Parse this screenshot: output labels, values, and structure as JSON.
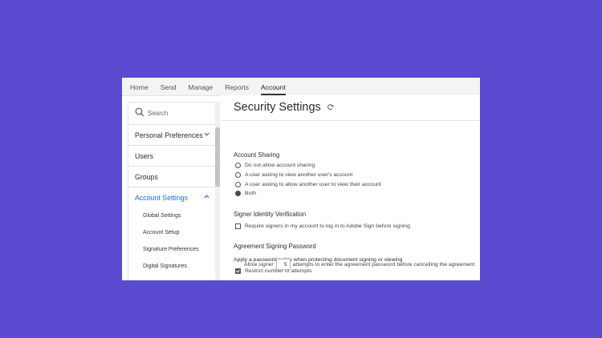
{
  "nav": {
    "items": [
      {
        "label": "Home"
      },
      {
        "label": "Send"
      },
      {
        "label": "Manage"
      },
      {
        "label": "Reports"
      },
      {
        "label": "Account"
      }
    ],
    "active": "Account"
  },
  "sidebar": {
    "search_placeholder": "Search",
    "items": [
      {
        "label": "Personal Preferences",
        "chevron": "chevron-down-icon"
      },
      {
        "label": "Users"
      },
      {
        "label": "Groups"
      },
      {
        "label": "Account Settings",
        "chevron": "chevron-up-icon"
      }
    ],
    "subitems": [
      {
        "label": "Global Settings"
      },
      {
        "label": "Account Setup"
      },
      {
        "label": "Signature Preferences"
      },
      {
        "label": "Digital Signatures"
      }
    ]
  },
  "main": {
    "title": "Security Settings",
    "account_sharing": {
      "heading": "Account Sharing",
      "options": [
        {
          "label": "Do not allow account sharing",
          "selected": false
        },
        {
          "label": "A user asking to view another user's account",
          "selected": false
        },
        {
          "label": "A user asking to allow another user to view their account",
          "selected": false
        },
        {
          "label": "Both",
          "selected": true
        }
      ]
    },
    "signer_identity": {
      "heading": "Signer Identity Verification",
      "checkbox_label": "Require signers in my account to log in to Adobe Sign before signing",
      "checked": false
    },
    "agreement_password": {
      "heading": "Agreement Signing Password",
      "policy_text": "Apply a password policy when protecting document signing or viewing",
      "restrict_label": "Restrict number of attempts",
      "restrict_checked": true,
      "attempts_prefix": "Allow signer",
      "attempts_value": "5",
      "attempts_suffix": "attempts to enter the agreement password before cancelling the agreement"
    }
  },
  "colors": {
    "background": "#5b4bd0",
    "accent": "#1473e6"
  }
}
